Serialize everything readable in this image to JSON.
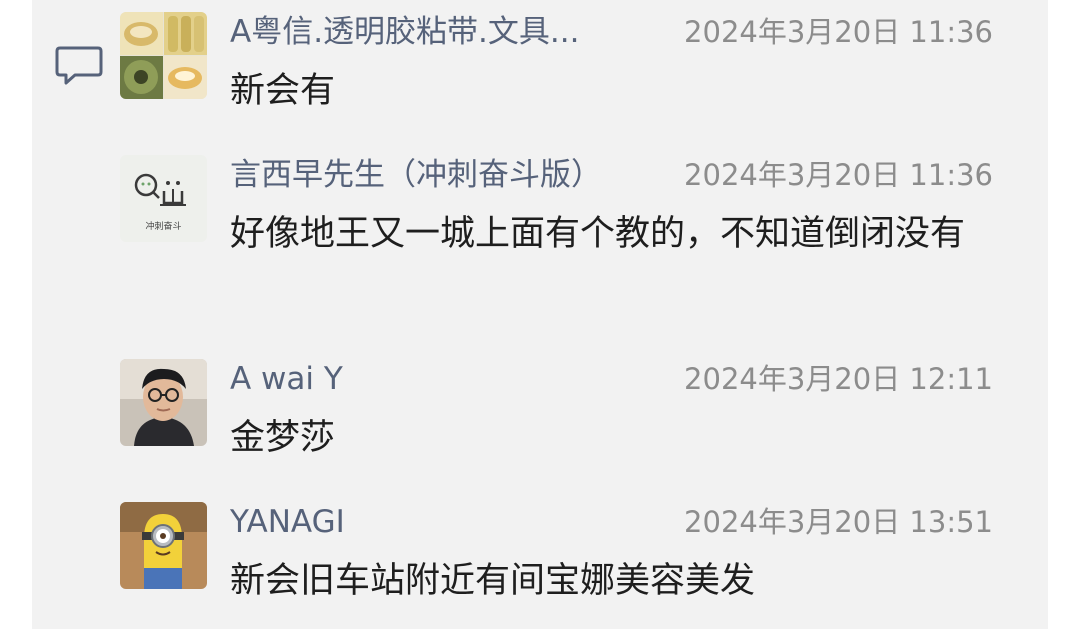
{
  "icons": {
    "comment": "comment-bubble-icon"
  },
  "comments": [
    {
      "name": "A粤信.透明胶粘带.文具...",
      "time": "2024年3月20日 11:36",
      "text": "新会有",
      "avatar": "tape-rolls-avatar"
    },
    {
      "name": "言西早先生（冲刺奋斗版）",
      "time": "2024年3月20日 11:36",
      "text": "好像地王又一城上面有个教的，不知道倒闭没有",
      "avatar": "cartoon-figure-avatar",
      "avatar_caption": "冲刺奋斗"
    },
    {
      "name": "A wai Y",
      "time": "2024年3月20日 12:11",
      "text": "金梦莎",
      "avatar": "person-photo-avatar"
    },
    {
      "name": "YANAGI",
      "time": "2024年3月20日 13:51",
      "text": "新会旧车站附近有间宝娜美容美发",
      "avatar": "minion-avatar"
    }
  ],
  "colors": {
    "name": "#56627a",
    "time": "#8c8c8c",
    "text": "#1e1e1e",
    "panel_bg": "#f2f2f2"
  }
}
